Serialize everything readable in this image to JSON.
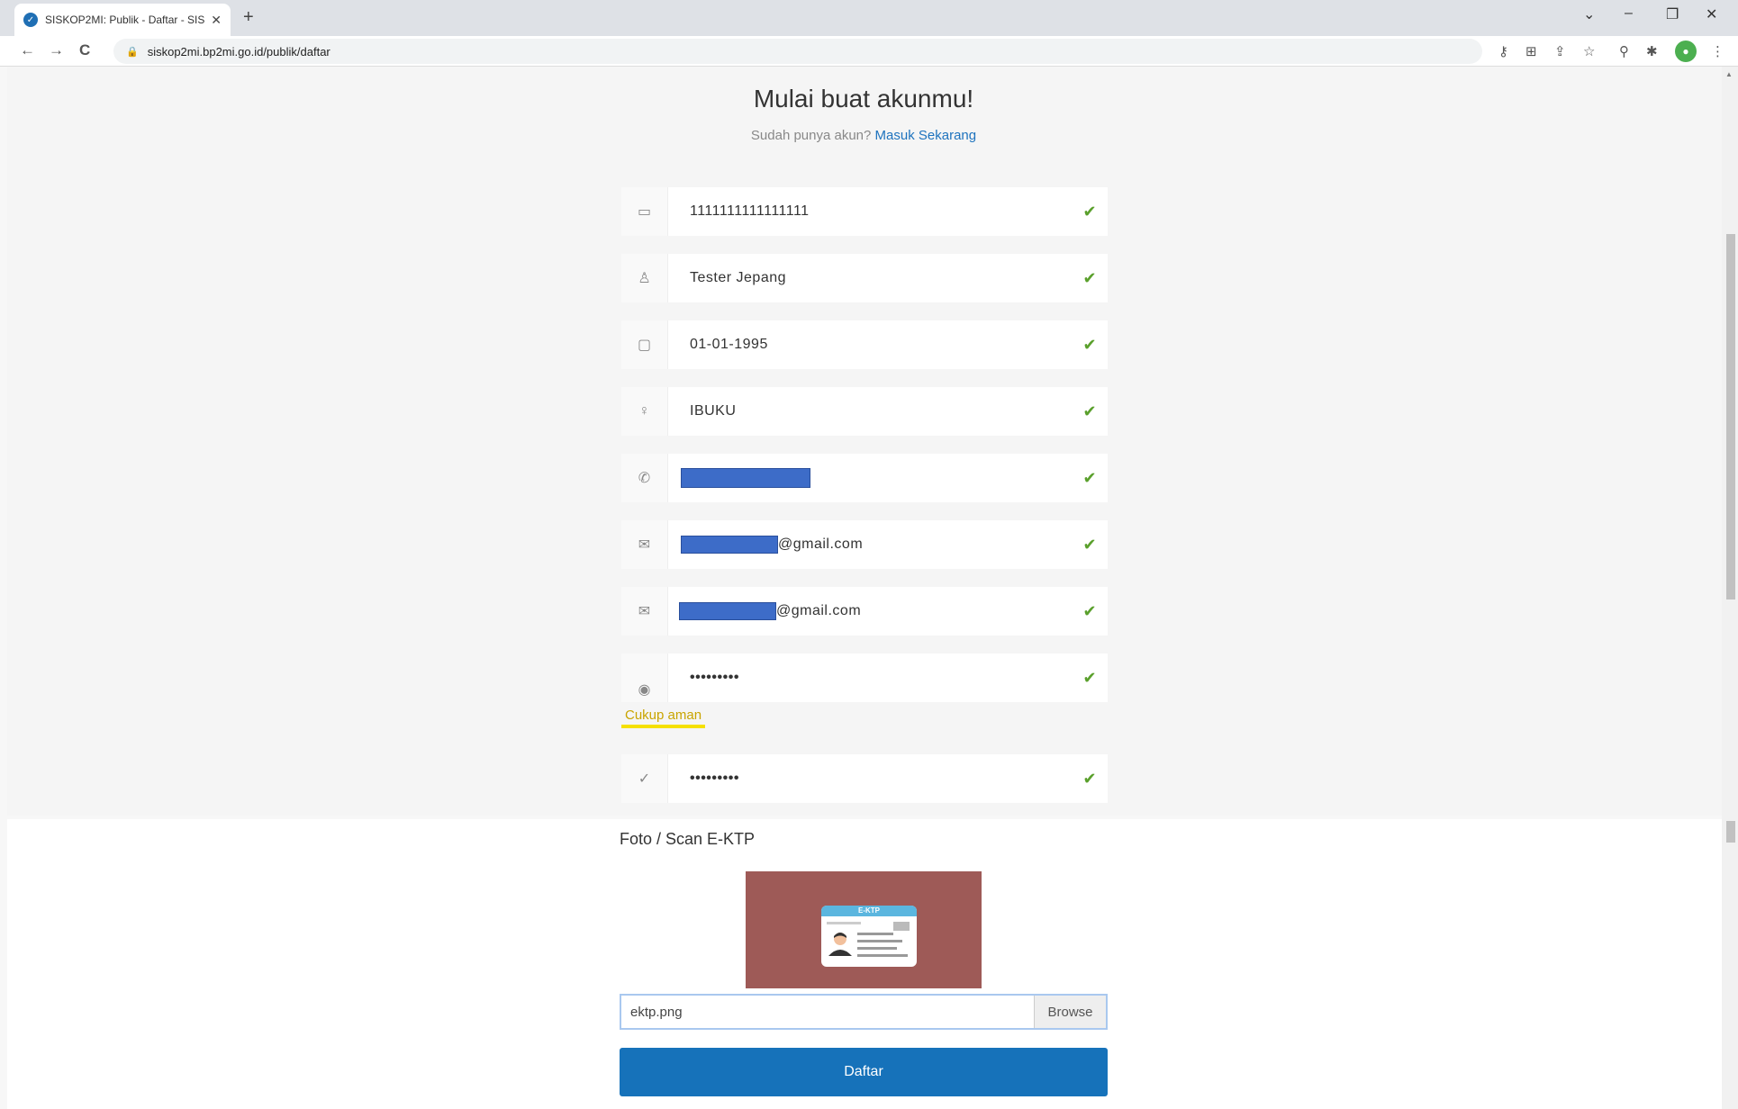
{
  "browser": {
    "tab_title": "SISKOP2MI: Publik - Daftar - SISK",
    "tab_close": "✕",
    "new_tab": "+",
    "url": "siskop2mi.bp2mi.go.id/publik/daftar",
    "nav_back": "←",
    "nav_forward": "→",
    "nav_reload": "C"
  },
  "header": {
    "title": "Mulai buat akunmu!",
    "subtitle_prefix": "Sudah punya akun?",
    "login_link": "Masuk Sekarang"
  },
  "form": {
    "nik": "1111111111111111",
    "name": "Tester Jepang",
    "birth_date": "01-01-1995",
    "mother_name": "IBUKU",
    "email_suffix": "@gmail.com",
    "email_confirm_suffix": "@gmail.com",
    "password": "•••••••••",
    "password_strength": "Cukup aman",
    "password_confirm": "•••••••••",
    "check_mark": "✔"
  },
  "upload": {
    "label": "Foto / Scan E-KTP",
    "card_band": "E-KTP",
    "file_name": "ektp.png",
    "browse_label": "Browse"
  },
  "submit_label": "Daftar",
  "colors": {
    "primary": "#1672ba",
    "check": "#5aa02c",
    "strength": "#f5e000",
    "redaction": "#3d6cc8"
  }
}
